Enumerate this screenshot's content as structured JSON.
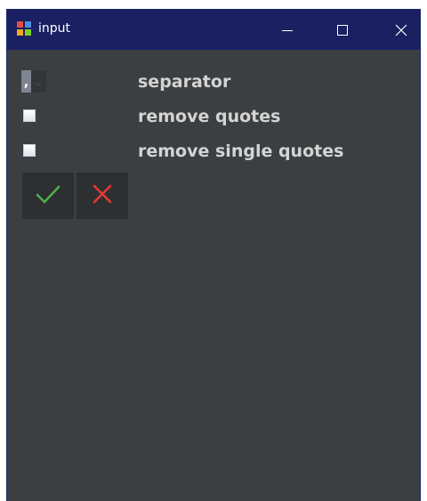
{
  "window": {
    "title": "input"
  },
  "titlebar": {
    "app_icon": "app-grid-icon",
    "minimize_icon": "minimize-icon",
    "maximize_icon": "maximize-icon",
    "close_icon": "close-icon"
  },
  "form": {
    "separator": {
      "value": ",",
      "label": "separator",
      "arrow_icon": "chevron-down-icon"
    },
    "remove_quotes": {
      "checked": false,
      "label": "remove quotes"
    },
    "remove_single_quotes": {
      "checked": false,
      "label": "remove single quotes"
    }
  },
  "actions": {
    "ok_icon": "checkmark-icon",
    "cancel_icon": "cross-icon"
  },
  "colors": {
    "titlebar": "#1a2062",
    "background": "#3c3f41",
    "label": "#d4d4d4",
    "ok": "#4caf50",
    "cancel": "#e53935"
  }
}
